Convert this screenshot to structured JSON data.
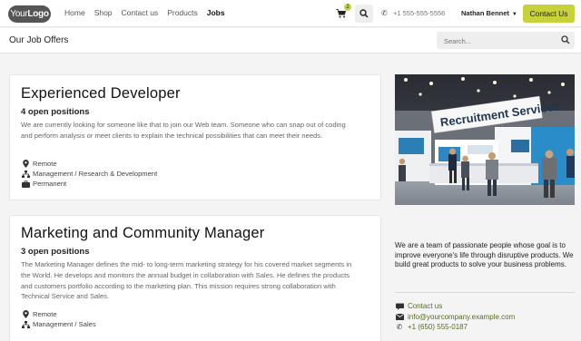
{
  "nav": {
    "logo_your": "Your",
    "logo_logo": "Logo",
    "links": [
      "Home",
      "Shop",
      "Contact us",
      "Products",
      "Jobs"
    ],
    "active_link": "Jobs",
    "cart_count": "2",
    "phone": "+1 555-555-5556",
    "user_name": "Nathan Bennet",
    "contact_button": "Contact Us"
  },
  "subheader": {
    "title": "Our Job Offers",
    "search_placeholder": "Search..."
  },
  "jobs": [
    {
      "title": "Experienced Developer",
      "positions": "4 open positions",
      "description": "We are currently looking for someone like that to join our Web team. Someone who can snap out of coding and perform analysis or meet clients to explain the technical possibilities that can meet their needs.",
      "location": "Remote",
      "department": "Management / Research & Development",
      "contract": "Permanent"
    },
    {
      "title": "Marketing and Community Manager",
      "positions": "3 open positions",
      "description": "The Marketing Manager defines the mid- to long-term marketing strategy for his covered market segments in the World. He develops and monitors the annual budget in collaboration with Sales. He defines the products and customers portfolio according to the marketing plan. This mission requires strong collaboration with Technical Service and Sales.",
      "location": "Remote",
      "department": "Management / Sales"
    }
  ],
  "sidebar": {
    "photo_sign": "Recruitment Services",
    "about": "We are a team of passionate people whose goal is to improve everyone's life through disruptive products. We build great products to solve your business problems.",
    "contact_label": "Contact us",
    "email": "info@yourcompany.example.com",
    "phone": "+1 (650) 555-0187"
  },
  "colors": {
    "accent": "#c7d23b",
    "link": "#556b22"
  }
}
